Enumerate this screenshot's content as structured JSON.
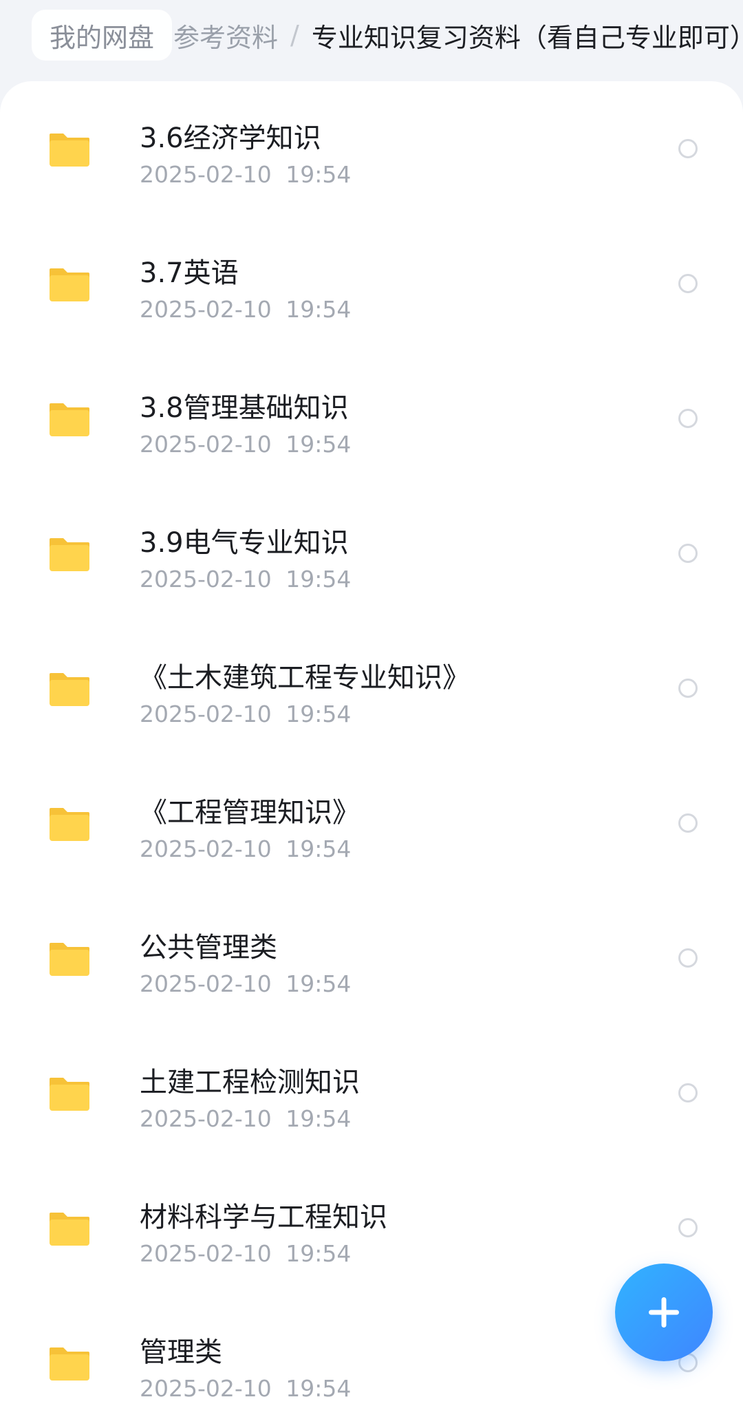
{
  "breadcrumb": {
    "root": "我的网盘",
    "middle": "参考资料",
    "separator": "/",
    "current": "专业知识复习资料（看自己专业即可）"
  },
  "colors": {
    "folder": "#ffd44d",
    "folder_tab": "#f7c238",
    "accent": "#3f8cff"
  },
  "file_list": {
    "items": [
      {
        "name": "3.6经济学知识",
        "time": "2025-02-10  19:54",
        "icon": "folder-icon"
      },
      {
        "name": "3.7英语",
        "time": "2025-02-10  19:54",
        "icon": "folder-icon"
      },
      {
        "name": "3.8管理基础知识",
        "time": "2025-02-10  19:54",
        "icon": "folder-icon"
      },
      {
        "name": "3.9电气专业知识",
        "time": "2025-02-10  19:54",
        "icon": "folder-icon"
      },
      {
        "name": "《土木建筑工程专业知识》",
        "time": "2025-02-10  19:54",
        "icon": "folder-icon"
      },
      {
        "name": "《工程管理知识》",
        "time": "2025-02-10  19:54",
        "icon": "folder-icon"
      },
      {
        "name": "公共管理类",
        "time": "2025-02-10  19:54",
        "icon": "folder-icon"
      },
      {
        "name": "土建工程检测知识",
        "time": "2025-02-10  19:54",
        "icon": "folder-icon"
      },
      {
        "name": "材料科学与工程知识",
        "time": "2025-02-10  19:54",
        "icon": "folder-icon"
      },
      {
        "name": "管理类",
        "time": "2025-02-10  19:54",
        "icon": "folder-icon"
      }
    ]
  },
  "fab": {
    "icon": "plus-icon"
  }
}
